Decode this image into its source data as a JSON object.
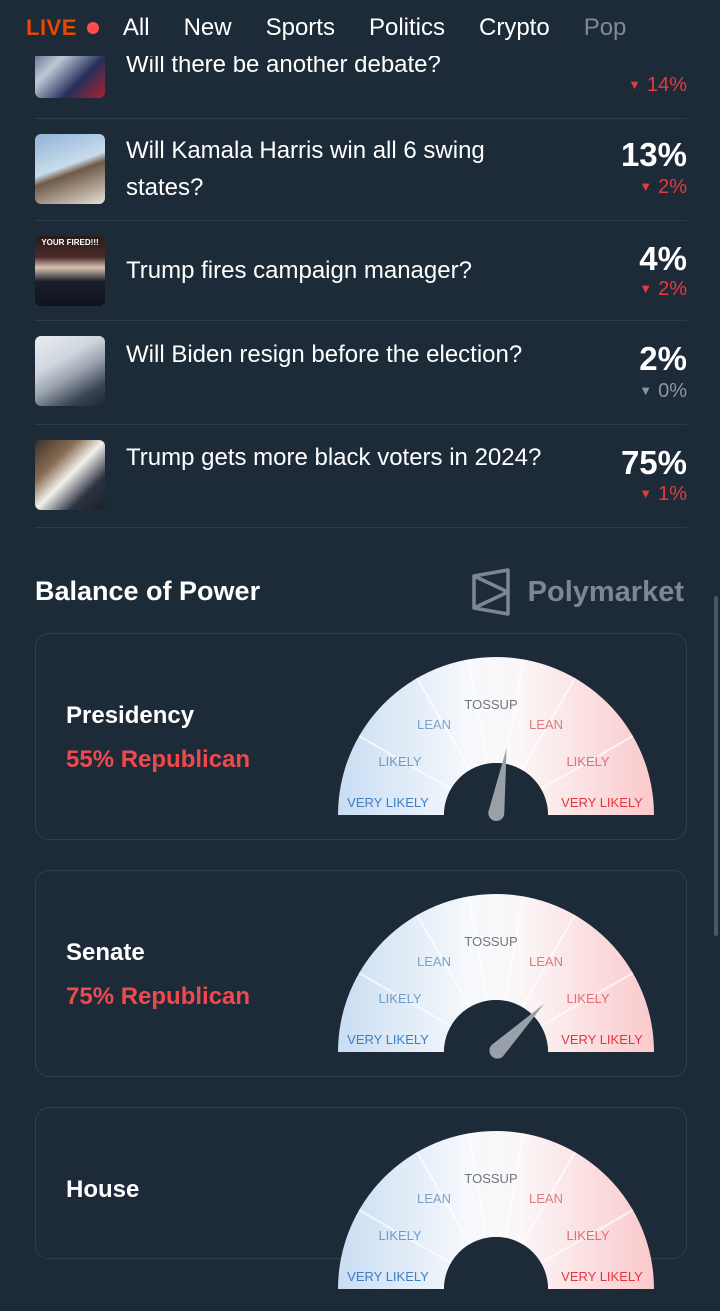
{
  "nav": {
    "live": "LIVE",
    "tabs": [
      "All",
      "New",
      "Sports",
      "Politics",
      "Crypto",
      "Pop"
    ]
  },
  "markets": [
    {
      "question": "Will there be another debate?",
      "percent": "",
      "change": "14%",
      "direction": "down"
    },
    {
      "question": "Will Kamala Harris win all 6 swing states?",
      "percent": "13%",
      "change": "2%",
      "direction": "down"
    },
    {
      "question": "Trump fires campaign manager?",
      "percent": "4%",
      "change": "2%",
      "direction": "down",
      "thumb_text": "YOUR FIRED!!!"
    },
    {
      "question": "Will Biden resign before the election?",
      "percent": "2%",
      "change": "0%",
      "direction": "neutral"
    },
    {
      "question": "Trump gets more black voters in 2024?",
      "percent": "75%",
      "change": "1%",
      "direction": "down"
    }
  ],
  "balance": {
    "title": "Balance of Power",
    "brand": "Polymarket",
    "gauge_labels": {
      "tossup": "TOSSUP",
      "lean_left": "LEAN",
      "lean_right": "LEAN",
      "likely_left": "LIKELY",
      "likely_right": "LIKELY",
      "very_left": "VERY LIKELY",
      "very_right": "VERY LIKELY"
    },
    "cards": [
      {
        "name": "Presidency",
        "summary": "55% Republican",
        "republican_share": 0.55
      },
      {
        "name": "Senate",
        "summary": "75% Republican",
        "republican_share": 0.75
      },
      {
        "name": "House",
        "summary": "",
        "republican_share": null
      }
    ]
  },
  "colors": {
    "background": "#1d2b39",
    "live": "#e64800",
    "down": "#e23c3c",
    "republican": "#f0494d",
    "democrat_blue": "#4a90d9"
  }
}
